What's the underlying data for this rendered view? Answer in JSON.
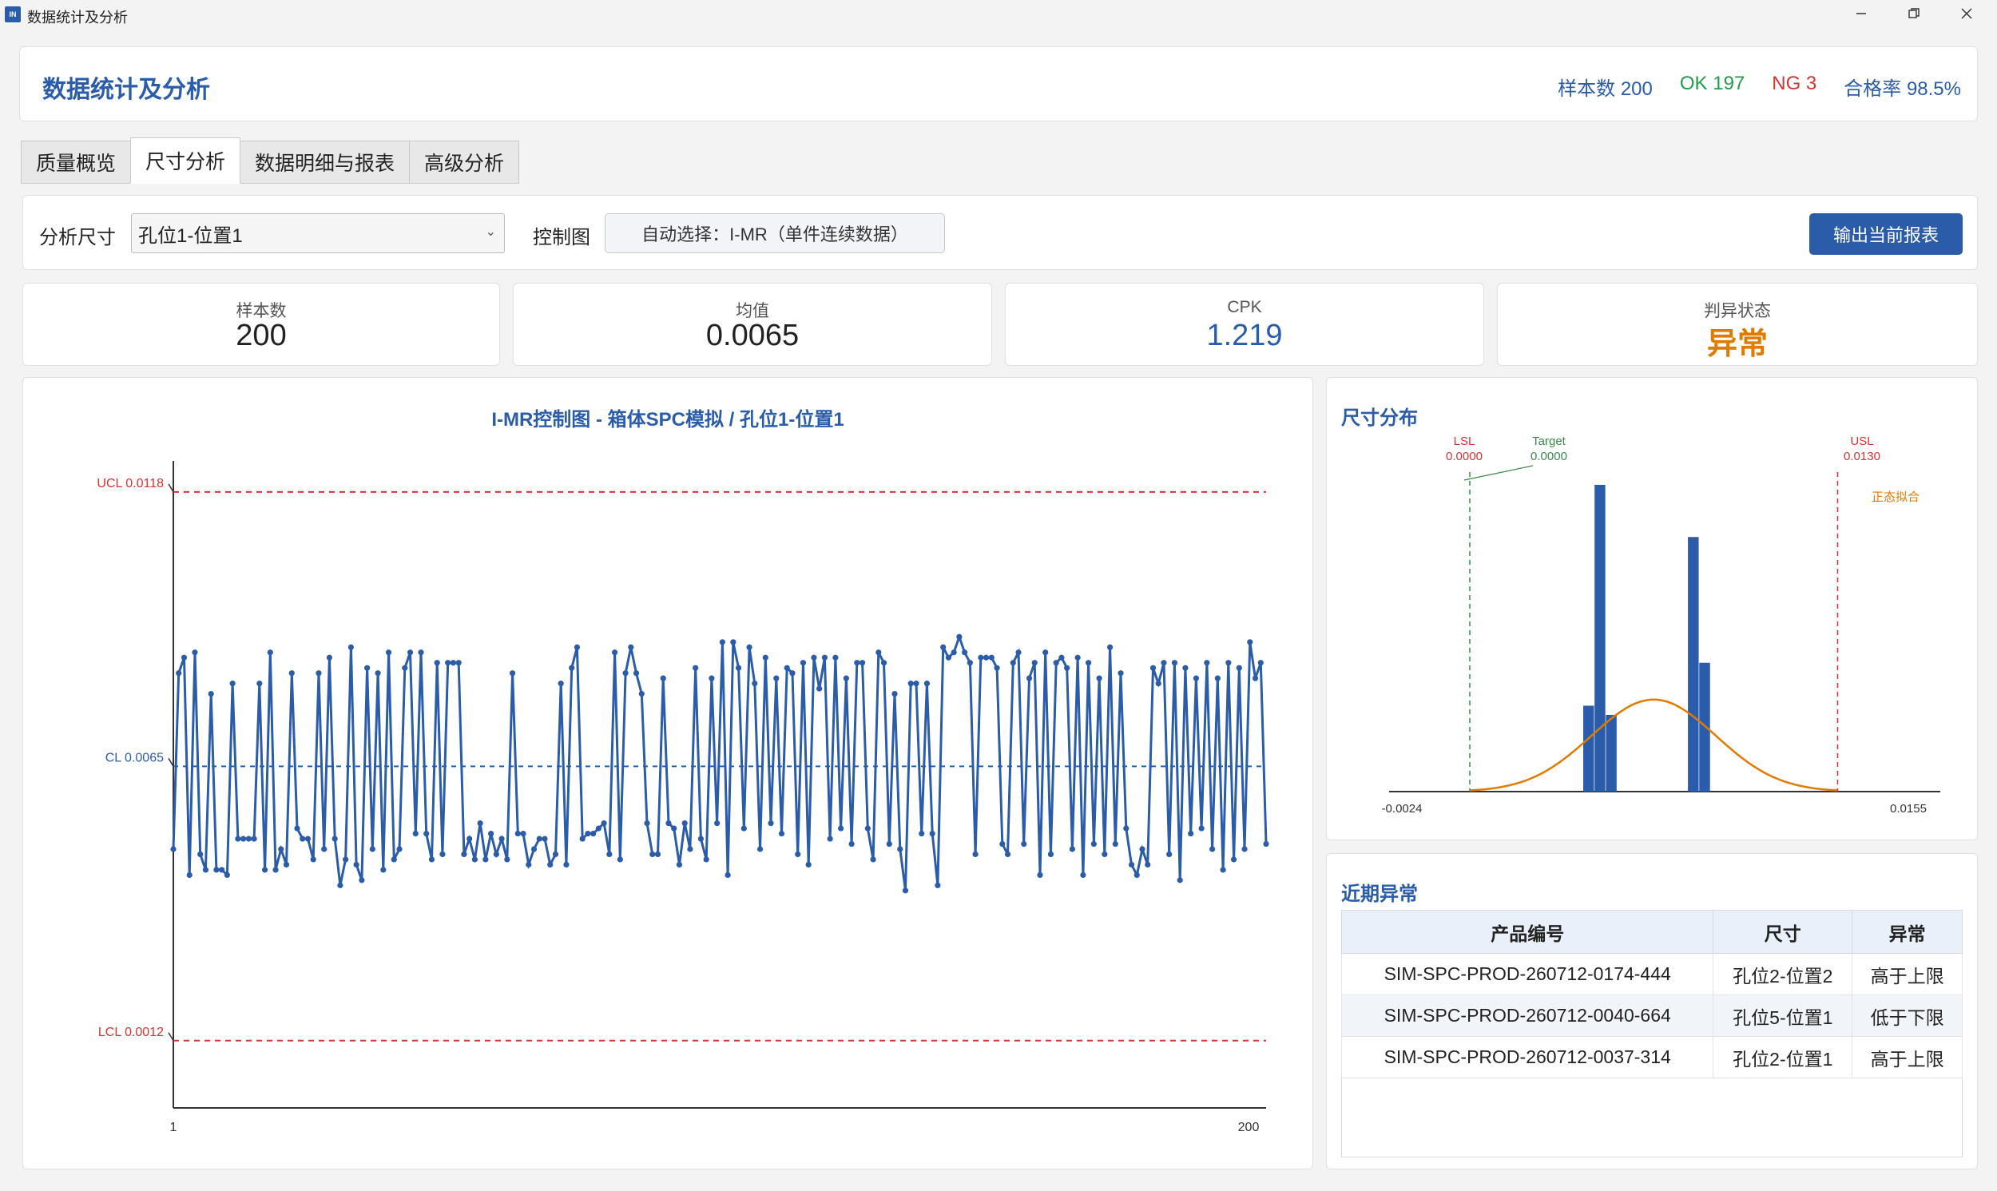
{
  "window": {
    "title": "数据统计及分析",
    "icon_text": "IN",
    "minimize_icon": "minimize-icon",
    "restore_icon": "restore-icon",
    "close_icon": "close-icon"
  },
  "header": {
    "title": "数据统计及分析",
    "sample_count": "样本数 200",
    "ok": "OK 197",
    "ng": "NG 3",
    "pass_rate": "合格率 98.5%",
    "colors": {
      "title": "#2a5caa",
      "ok": "#1e9e4a",
      "ng": "#d63333",
      "info": "#2a5caa"
    }
  },
  "tabs": [
    {
      "label": "质量概览",
      "active": false
    },
    {
      "label": "尺寸分析",
      "active": true
    },
    {
      "label": "数据明细与报表",
      "active": false
    },
    {
      "label": "高级分析",
      "active": false
    }
  ],
  "toolbar": {
    "dimension_label": "分析尺寸",
    "dimension_value": "孔位1-位置1",
    "chart_label": "控制图",
    "chart_type": "自动选择：I-MR（单件连续数据）",
    "export_label": "输出当前报表"
  },
  "kpis": [
    {
      "label": "样本数",
      "value": "200",
      "color": "#222222"
    },
    {
      "label": "均值",
      "value": "0.0065",
      "color": "#222222"
    },
    {
      "label": "CPK",
      "value": "1.219",
      "color": "#2a5caa"
    },
    {
      "label": "判异状态",
      "value": "异常",
      "color": "#e07b00"
    }
  ],
  "control_chart": {
    "title": "I-MR控制图 - 箱体SPC模拟 / 孔位1-位置1",
    "ucl_label": "UCL 0.0118",
    "cl_label": "CL 0.0065",
    "lcl_label": "LCL 0.0012",
    "x_start": "1",
    "x_end": "200"
  },
  "chart_data": [
    {
      "type": "line",
      "title": "I-MR控制图 - 箱体SPC模拟 / 孔位1-位置1",
      "x": [
        1,
        200
      ],
      "ucl": 0.0118,
      "cl": 0.0065,
      "lcl": 0.0012,
      "ylim": [
        -0.0001,
        0.0124
      ],
      "series": [
        {
          "values": [
            0.0049,
            0.0083,
            0.0086,
            0.0044,
            0.0087,
            0.0048,
            0.0045,
            0.0079,
            0.0045,
            0.0045,
            0.0044,
            0.0081,
            0.0051,
            0.0051,
            0.0051,
            0.0051,
            0.0081,
            0.0045,
            0.0087,
            0.0045,
            0.0049,
            0.0046,
            0.0083,
            0.0053,
            0.0051,
            0.0051,
            0.0047,
            0.0083,
            0.0049,
            0.0086,
            0.0051,
            0.0042,
            0.0047,
            0.0088,
            0.0046,
            0.0043,
            0.0084,
            0.0049,
            0.0083,
            0.0045,
            0.0087,
            0.0047,
            0.0049,
            0.0084,
            0.0087,
            0.0052,
            0.0087,
            0.0052,
            0.0047,
            0.0085,
            0.0048,
            0.0085,
            0.0085,
            0.0085,
            0.0048,
            0.0051,
            0.0047,
            0.0054,
            0.0047,
            0.0052,
            0.0048,
            0.0051,
            0.0047,
            0.0083,
            0.0052,
            0.0052,
            0.0046,
            0.0049,
            0.0051,
            0.0051,
            0.0046,
            0.0048,
            0.0081,
            0.0046,
            0.0084,
            0.0088,
            0.0051,
            0.0052,
            0.0052,
            0.0053,
            0.0054,
            0.0048,
            0.0087,
            0.0047,
            0.0083,
            0.0088,
            0.0083,
            0.0079,
            0.0054,
            0.0048,
            0.0048,
            0.0082,
            0.0054,
            0.0053,
            0.0046,
            0.0054,
            0.0049,
            0.0084,
            0.0051,
            0.0047,
            0.0082,
            0.0054,
            0.0089,
            0.0044,
            0.0089,
            0.0084,
            0.0053,
            0.0088,
            0.0081,
            0.0049,
            0.0086,
            0.0054,
            0.0082,
            0.0052,
            0.0084,
            0.0083,
            0.0048,
            0.0085,
            0.0046,
            0.0086,
            0.008,
            0.0086,
            0.0051,
            0.0086,
            0.0053,
            0.0082,
            0.005,
            0.0085,
            0.0085,
            0.0053,
            0.0047,
            0.0087,
            0.0085,
            0.005,
            0.0079,
            0.0049,
            0.0041,
            0.0081,
            0.0081,
            0.0052,
            0.0081,
            0.0052,
            0.0042,
            0.0088,
            0.0086,
            0.0087,
            0.009,
            0.0087,
            0.0085,
            0.0048,
            0.0086,
            0.0086,
            0.0086,
            0.0084,
            0.005,
            0.0048,
            0.0085,
            0.0087,
            0.005,
            0.0082,
            0.0085,
            0.0044,
            0.0087,
            0.0048,
            0.0085,
            0.0086,
            0.0084,
            0.0049,
            0.0086,
            0.0044,
            0.0085,
            0.005,
            0.0082,
            0.0048,
            0.0088,
            0.005,
            0.0083,
            0.0053,
            0.0046,
            0.0044,
            0.0049,
            0.0046,
            0.0084,
            0.0081,
            0.0085,
            0.0048,
            0.0085,
            0.0043,
            0.0084,
            0.0052,
            0.0082,
            0.0053,
            0.0085,
            0.0049,
            0.0082,
            0.0045,
            0.0085,
            0.0047,
            0.0084,
            0.0049,
            0.0089,
            0.0082,
            0.0085,
            0.005
          ]
        }
      ]
    },
    {
      "type": "bar",
      "title": "尺寸分布",
      "xlim": [
        -0.0024,
        0.0155
      ],
      "bins": [
        0.0042,
        0.0046,
        0.005,
        0.0079,
        0.0083
      ],
      "counts": [
        28,
        100,
        25,
        83,
        42
      ],
      "normal_fit": {
        "label": "正态拟合",
        "mean": 0.0065,
        "peak_count": 30
      },
      "lsl": 0.0,
      "usl": 0.013,
      "target": 0.0
    }
  ],
  "distribution": {
    "title": "尺寸分布",
    "lsl_label": "LSL",
    "lsl_value": "0.0000",
    "target_label": "Target",
    "target_value": "0.0000",
    "usl_label": "USL",
    "usl_value": "0.0130",
    "fit_label": "正态拟合",
    "x_min_label": "-0.0024",
    "x_max_label": "0.0155"
  },
  "anomalies": {
    "title": "近期异常",
    "columns": [
      "产品编号",
      "尺寸",
      "异常"
    ],
    "rows": [
      [
        "SIM-SPC-PROD-260712-0174-444",
        "孔位2-位置2",
        "高于上限"
      ],
      [
        "SIM-SPC-PROD-260712-0040-664",
        "孔位5-位置1",
        "低于下限"
      ],
      [
        "SIM-SPC-PROD-260712-0037-314",
        "孔位2-位置1",
        "高于上限"
      ]
    ]
  }
}
